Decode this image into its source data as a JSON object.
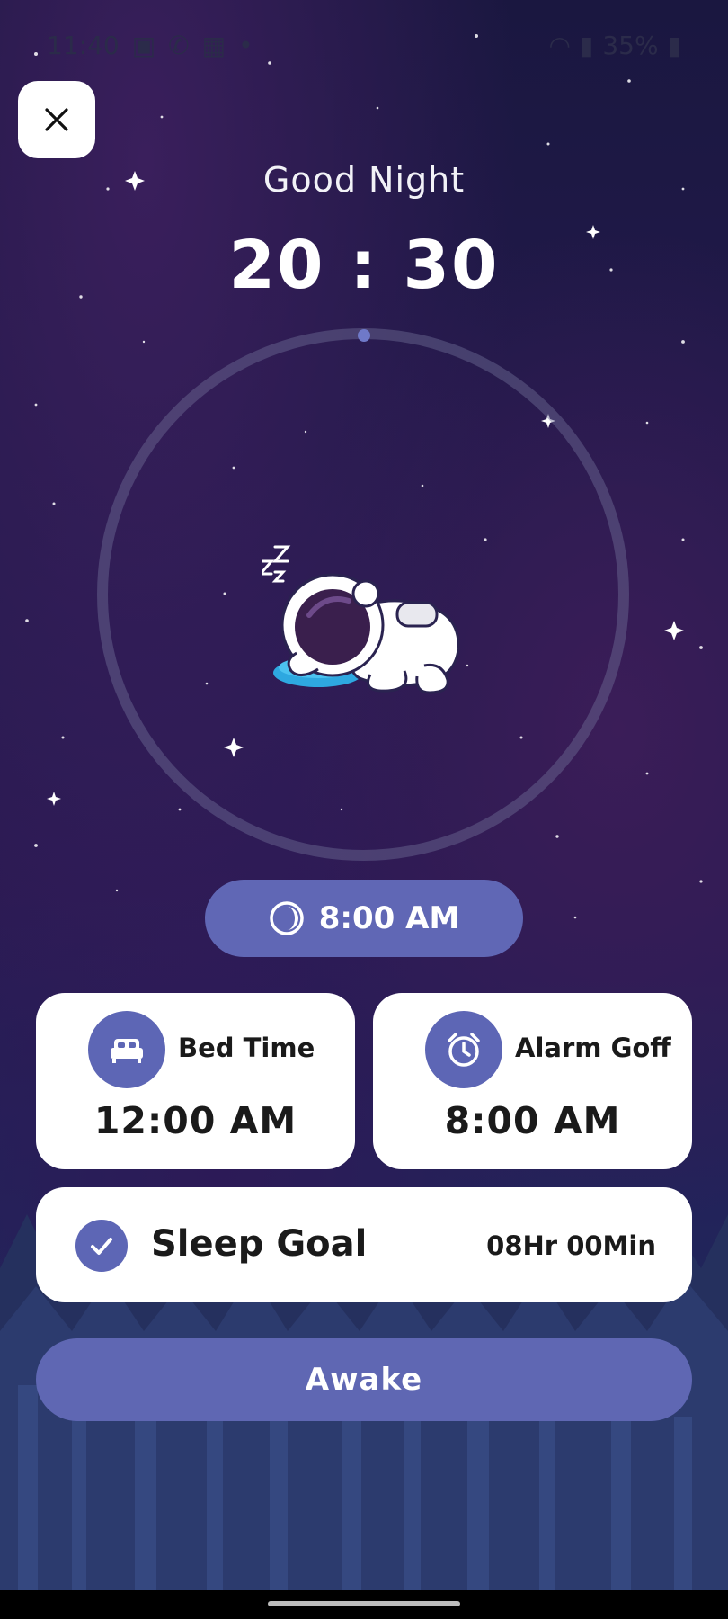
{
  "status_bar": {
    "time": "11:40",
    "battery": "35%"
  },
  "header": {
    "greeting": "Good Night",
    "clock": "20 : 30"
  },
  "wake_pill": {
    "time": "8:00 AM",
    "icon": "moon-half-icon"
  },
  "bed_card": {
    "title": "Bed Time",
    "value": "12:00 AM",
    "icon": "bed-icon"
  },
  "alarm_card": {
    "title": "Alarm Goff",
    "value": "8:00 AM",
    "icon": "alarm-clock-icon"
  },
  "sleep_goal": {
    "label": "Sleep Goal",
    "value": "08Hr 00Min",
    "checked": true
  },
  "awake_button": {
    "label": "Awake"
  },
  "colors": {
    "accent": "#5f67b3",
    "card": "#ffffff",
    "background": "#221a4d"
  }
}
